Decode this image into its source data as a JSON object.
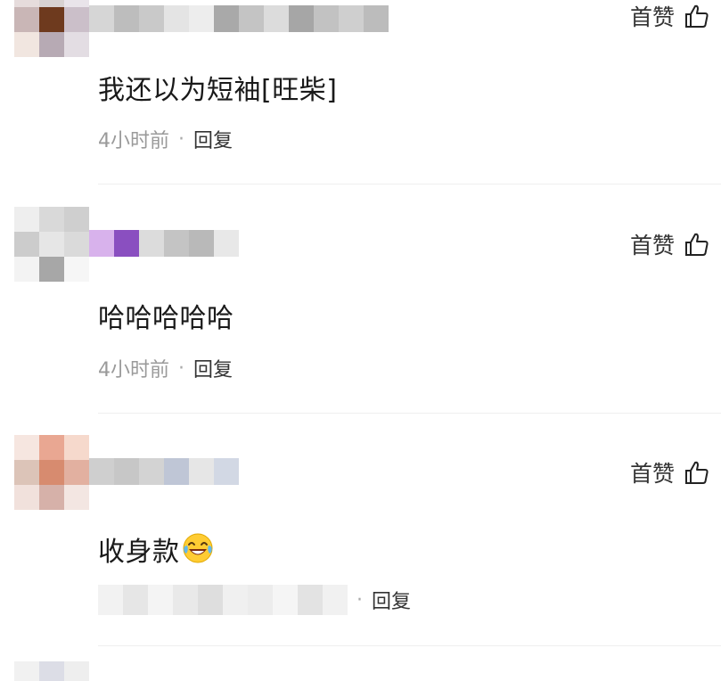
{
  "like_label": "首赞",
  "comments": [
    {
      "text": "我还以为短袖[旺柴]",
      "time": "4小时前",
      "dot": "·",
      "reply": "回复"
    },
    {
      "text": "哈哈哈哈哈",
      "time": "4小时前",
      "dot": "·",
      "reply": "回复"
    },
    {
      "text": "收身款",
      "emoji": "laughing-tears-emoji",
      "time": "",
      "dot": "·",
      "reply": "回复"
    }
  ],
  "colors": {
    "reply": "#333333",
    "time": "#9a9a9a",
    "content": "#1a1a1a"
  }
}
